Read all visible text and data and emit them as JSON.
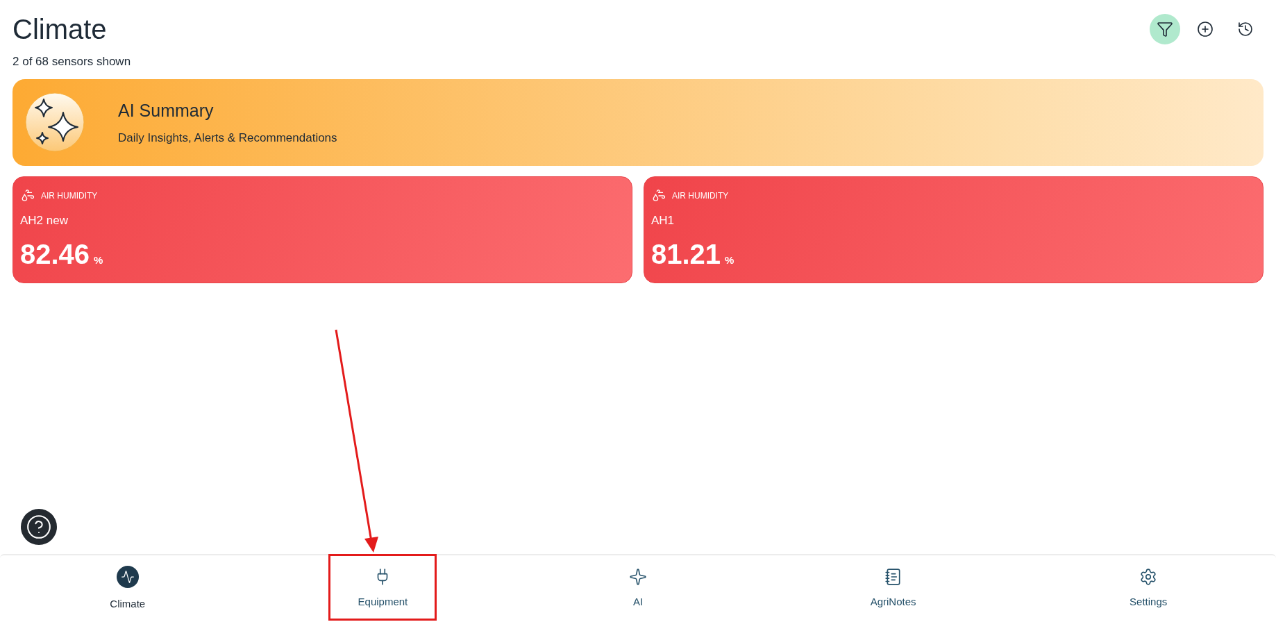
{
  "header": {
    "title": "Climate",
    "subtitle": "2 of 68 sensors shown"
  },
  "toolbar": [
    {
      "kind": "filter",
      "selected": true
    },
    {
      "kind": "add",
      "selected": false
    },
    {
      "kind": "history",
      "selected": false
    }
  ],
  "ai_summary": {
    "title": "AI Summary",
    "subtitle": "Daily Insights, Alerts & Recommendations"
  },
  "sensors": [
    {
      "category": "AIR HUMIDITY",
      "name": "AH2 new",
      "value": "82.46",
      "unit": "%"
    },
    {
      "category": "AIR HUMIDITY",
      "name": "AH1",
      "value": "81.21",
      "unit": "%"
    }
  ],
  "nav": [
    {
      "kind": "climate",
      "label": "Climate",
      "selected": true
    },
    {
      "kind": "equipment",
      "label": "Equipment",
      "selected": false
    },
    {
      "kind": "ai",
      "label": "AI",
      "selected": false
    },
    {
      "kind": "notes",
      "label": "AgriNotes",
      "selected": false
    },
    {
      "kind": "settings",
      "label": "Settings",
      "selected": false
    }
  ]
}
